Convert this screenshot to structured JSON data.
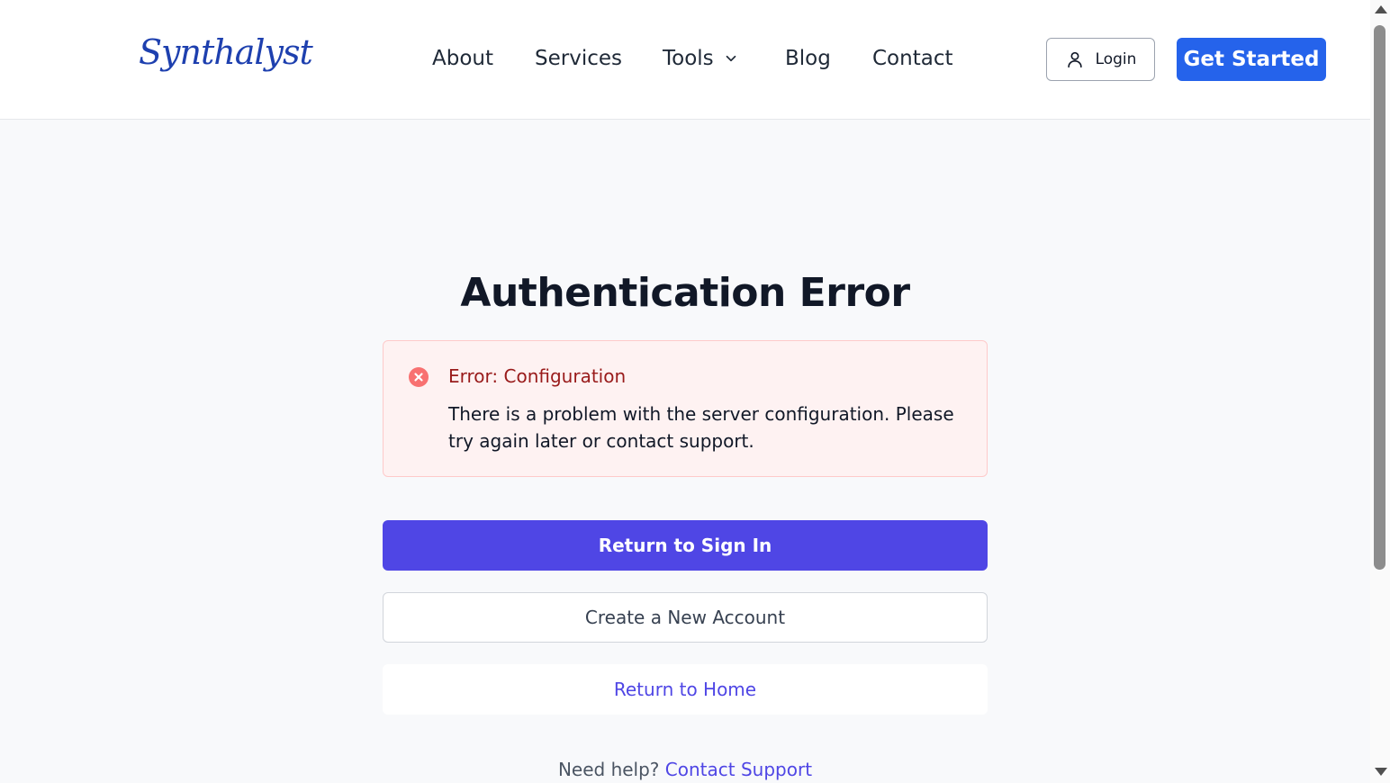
{
  "header": {
    "logo": "Synthalyst",
    "nav": {
      "about": "About",
      "services": "Services",
      "tools": "Tools",
      "blog": "Blog",
      "contact": "Contact"
    },
    "login_label": "Login",
    "cta_label": "Get Started"
  },
  "main": {
    "title": "Authentication Error",
    "alert": {
      "title": "Error: Configuration",
      "message": "There is a problem with the server configuration. Please try again later or contact support."
    },
    "buttons": {
      "return_sign_in": "Return to Sign In",
      "create_account": "Create a New Account",
      "return_home": "Return to Home"
    },
    "help": {
      "prefix": "Need help?",
      "link": "Contact Support"
    }
  },
  "colors": {
    "brand_blue": "#2563eb",
    "primary_indigo": "#4f46e5",
    "error_red": "#ef4444",
    "error_text": "#991b1b",
    "alert_bg": "#fef2f2"
  },
  "icons": {
    "login": "user-icon",
    "tools_dropdown": "chevron-down-icon",
    "alert": "x-circle-icon"
  }
}
